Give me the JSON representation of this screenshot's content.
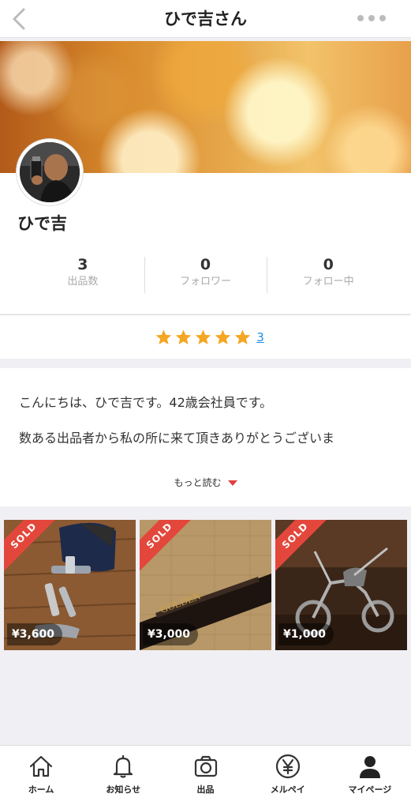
{
  "header": {
    "title": "ひで吉さん"
  },
  "profile": {
    "name": "ひで吉",
    "stats": [
      {
        "value": "3",
        "label": "出品数"
      },
      {
        "value": "0",
        "label": "フォロワー"
      },
      {
        "value": "0",
        "label": "フォロー中"
      }
    ],
    "rating": {
      "stars": 5,
      "count": "3",
      "star_color": "#f5a623"
    }
  },
  "bio": {
    "line1": "こんにちは、ひで吉です。42歳会社員です。",
    "line2": "数ある出品者から私の所に来て頂きありがとうございま",
    "read_more": "もっと読む"
  },
  "items": [
    {
      "badge": "SOLD",
      "price": "¥3,600"
    },
    {
      "badge": "SOLD",
      "price": "¥3,000"
    },
    {
      "badge": "SOLD",
      "price": "¥1,000"
    }
  ],
  "tabbar": [
    {
      "label": "ホーム",
      "icon": "home-icon"
    },
    {
      "label": "お知らせ",
      "icon": "bell-icon"
    },
    {
      "label": "出品",
      "icon": "camera-icon"
    },
    {
      "label": "メルペイ",
      "icon": "yen-icon"
    },
    {
      "label": "マイページ",
      "icon": "person-icon"
    }
  ],
  "colors": {
    "sold_badge": "#e3473c",
    "link": "#1a8fe0",
    "accent_caret": "#e04040"
  }
}
